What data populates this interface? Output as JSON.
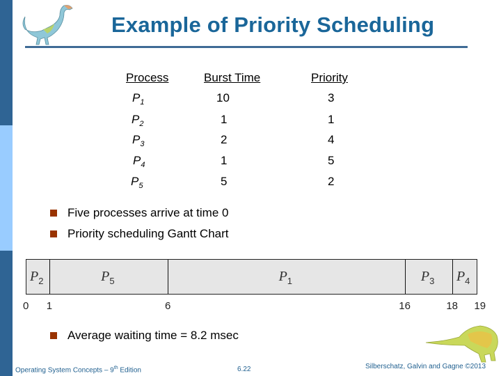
{
  "slide": {
    "title": "Example of Priority Scheduling",
    "table": {
      "headers": [
        "Process",
        "Burst Time",
        "Priority"
      ],
      "rows": [
        {
          "process": "P",
          "sub": "1",
          "burst": "10",
          "priority": "3"
        },
        {
          "process": "P",
          "sub": "2",
          "burst": "1",
          "priority": "1"
        },
        {
          "process": "P",
          "sub": "3",
          "burst": "2",
          "priority": "4"
        },
        {
          "process": "P",
          "sub": "4",
          "burst": "1",
          "priority": "5"
        },
        {
          "process": "P",
          "sub": "5",
          "burst": "5",
          "priority": "2"
        }
      ]
    },
    "bullets": [
      "Five processes arrive at time 0",
      "Priority scheduling Gantt Chart",
      "Average waiting time = 8.2 msec"
    ],
    "gantt": {
      "total": 19,
      "segments": [
        {
          "label": "P",
          "sub": "2",
          "start": 0,
          "end": 1
        },
        {
          "label": "P",
          "sub": "5",
          "start": 1,
          "end": 6
        },
        {
          "label": "P",
          "sub": "1",
          "start": 6,
          "end": 16
        },
        {
          "label": "P",
          "sub": "3",
          "start": 16,
          "end": 18
        },
        {
          "label": "P",
          "sub": "4",
          "start": 18,
          "end": 19
        }
      ],
      "ticks": [
        "0",
        "1",
        "6",
        "16",
        "18",
        "19"
      ]
    },
    "footer": {
      "book": "Operating System Concepts – 9",
      "book_sup": "th",
      "book_tail": " Edition",
      "page": "6.22",
      "copyright": "Silberschatz, Galvin and Gagne ©2013"
    },
    "colors": {
      "title": "#1a6699",
      "bullet": "#993300",
      "strip_dark": "#2f6494",
      "strip_light": "#99ccff"
    }
  }
}
